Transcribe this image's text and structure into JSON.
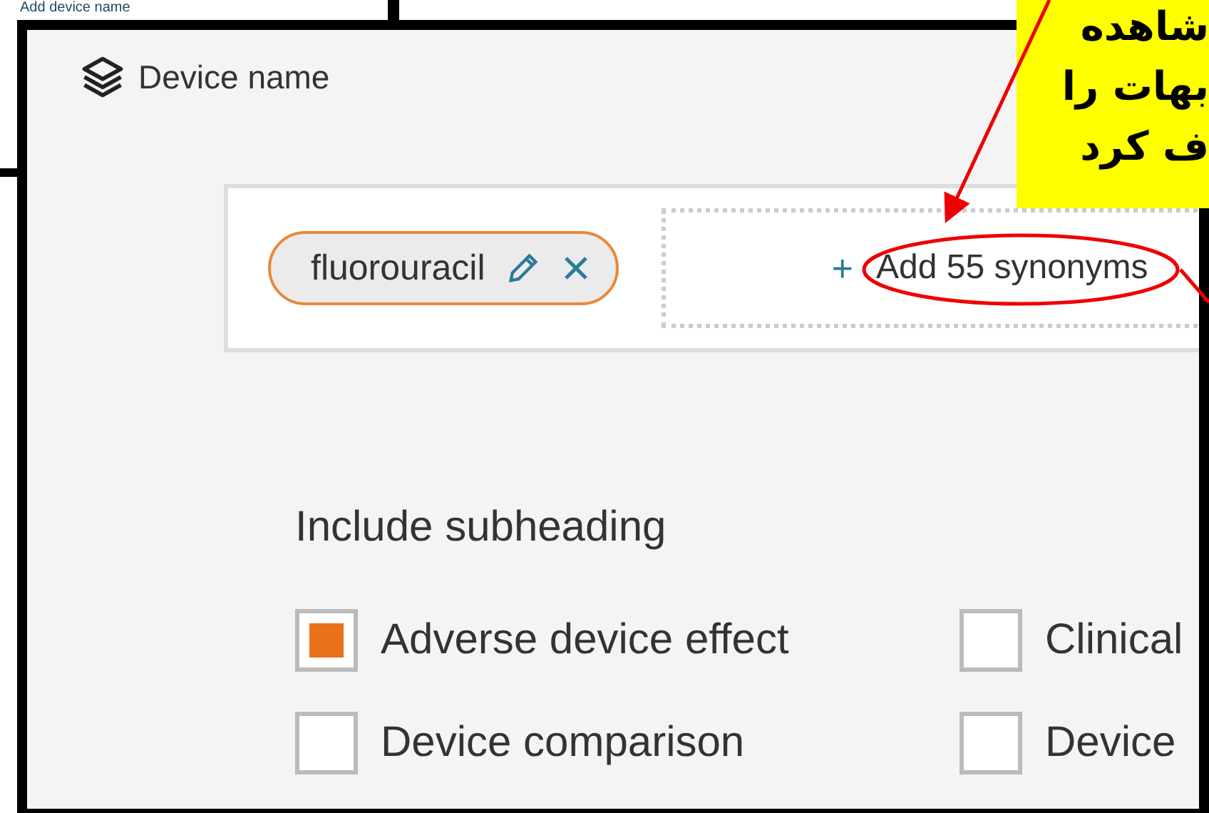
{
  "background_window": {
    "add_link": "Add device name"
  },
  "panel": {
    "title": "Device name",
    "search_terms": [
      {
        "label": "fluorouracil"
      }
    ],
    "add_synonyms": {
      "icon": "+",
      "label": "Add 55 synonyms"
    },
    "subheading": {
      "title": "Include subheading",
      "options": [
        {
          "label": "Adverse device effect",
          "checked": true
        },
        {
          "label": "Clinical",
          "checked": false
        },
        {
          "label": "Device comparison",
          "checked": false
        },
        {
          "label": "Device",
          "checked": false
        }
      ]
    }
  },
  "annotation": {
    "note_lines": [
      "شاهده",
      "بهات را",
      "ف کرد"
    ]
  }
}
